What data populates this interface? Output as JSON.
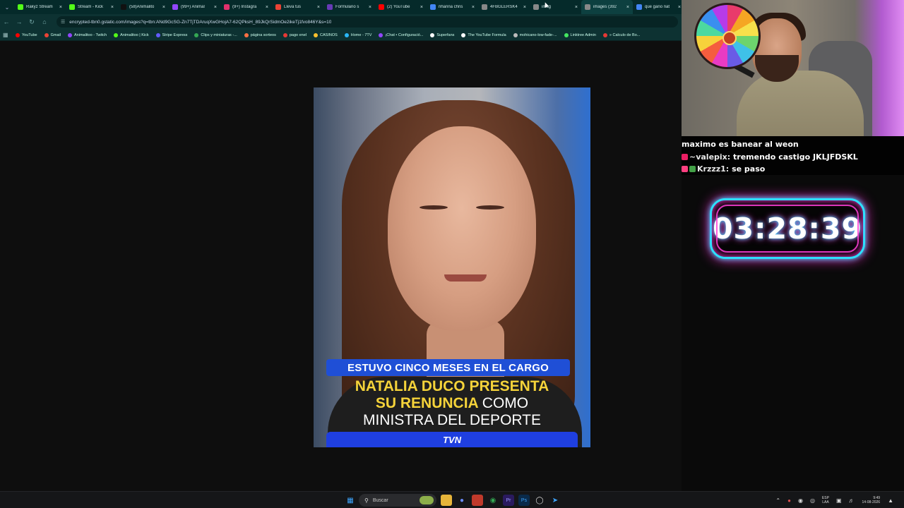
{
  "browser": {
    "tabs": [
      {
        "label": "Rakyz Stream",
        "icon": "kick-icon",
        "color": "#53fc18"
      },
      {
        "label": "Stream - Kick",
        "icon": "kick-icon",
        "color": "#53fc18"
      },
      {
        "label": "(58)Animalito",
        "icon": "tiktok-icon",
        "color": "#111111"
      },
      {
        "label": "(99+) Animal",
        "icon": "twitch-icon",
        "color": "#9146ff"
      },
      {
        "label": "(9+) Instagra",
        "icon": "instagram-icon",
        "color": "#e1306c"
      },
      {
        "label": "Lleva tus",
        "icon": "gmail-icon",
        "color": "#ea4335"
      },
      {
        "label": "Formulario s",
        "icon": "forms-icon",
        "color": "#673ab7"
      },
      {
        "label": "(2) YouTube",
        "icon": "youtube-icon",
        "color": "#ff0000"
      },
      {
        "label": "rihanna chris",
        "icon": "google-icon",
        "color": "#4285f4"
      },
      {
        "label": "4FBGLERSK4",
        "icon": "doc-icon",
        "color": "#888888"
      },
      {
        "label": "imag",
        "icon": "globe-icon",
        "color": "#888888"
      },
      {
        "label": "images (392",
        "icon": "globe-icon",
        "color": "#888888"
      },
      {
        "label": "que gano nat",
        "icon": "google-icon",
        "color": "#4285f4"
      },
      {
        "label": "cuanto",
        "icon": "google-icon",
        "color": "#4285f4"
      }
    ],
    "active_tab_index": 11,
    "url": "encrypted-tbn0.gstatic.com/images?q=tbn:ANd9GcSG-Zn7TjTDAruqXwGHojA7-62QPksH_89JkQrSidmOe2ikeTj1fvo846Y&s=10",
    "bookmarks": [
      {
        "label": "YouTube",
        "color": "#ff0000"
      },
      {
        "label": "Gmail",
        "color": "#ea4335"
      },
      {
        "label": "Animalitoo - Twitch",
        "color": "#9146ff"
      },
      {
        "label": "Animalitoo | Kick",
        "color": "#53fc18"
      },
      {
        "label": "Stripe Express",
        "color": "#635bff"
      },
      {
        "label": "Clips y miniaturas -...",
        "color": "#34a853"
      },
      {
        "label": "página sorteos",
        "color": "#ff7043"
      },
      {
        "label": "pago enel",
        "color": "#e53935"
      },
      {
        "label": "CASINOS",
        "color": "#fbc02d"
      },
      {
        "label": "Home - 7TV",
        "color": "#29b6f6"
      },
      {
        "label": "¡Chat • Configuració...",
        "color": "#9146ff"
      },
      {
        "label": "Superfans",
        "color": "#ffffff"
      },
      {
        "label": "The YouTube Formula",
        "color": "#ffffff"
      },
      {
        "label": "mohicano-low-fade-...",
        "color": "#bbbbbb"
      },
      {
        "label": "Linktree Admin",
        "color": "#43e660"
      },
      {
        "label": "» Calculo de Bo...",
        "color": "#e53935"
      }
    ]
  },
  "image": {
    "caption_top": "ESTUVO CINCO MESES EN EL CARGO",
    "caption_line1": "NATALIA DUCO PRESENTA",
    "caption_line2_yellow": "SU RENUNCIA",
    "caption_line2_white": "COMO",
    "caption_line3": "MINISTRA DEL DEPORTE",
    "logo": "TVN"
  },
  "chat": [
    {
      "user": "",
      "message": "maximo es banear al weon",
      "badge_color": ""
    },
    {
      "user": "~valepix:",
      "message": "tremendo castigo JKLJFDSKL",
      "badge_color": "#e91e63"
    },
    {
      "user": "Krzzz1:",
      "message": "se paso",
      "badge_color": "#ff4081"
    }
  ],
  "timer": "03:28:39",
  "taskbar": {
    "search_placeholder": "Buscar",
    "language_top": "ESP",
    "language_bottom": "LAA",
    "time": "9:49",
    "date": "14-08-2026"
  }
}
